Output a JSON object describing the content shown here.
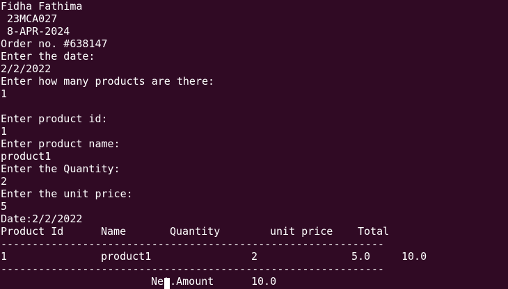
{
  "terminal": {
    "lines": [
      "Fidha Fathima",
      " 23MCA027",
      " 8-APR-2024",
      "Order no. #638147",
      "Enter the date:",
      "2/2/2022",
      "Enter how many products are there:",
      "1",
      "",
      "Enter product id:",
      "1",
      "Enter product name:",
      "product1",
      "Enter the Quantity:",
      "2",
      "Enter the unit price:",
      "5",
      "Date:2/2/2022"
    ],
    "table": {
      "headers": [
        "Product Id",
        "Name",
        "Quantity",
        "unit price",
        "Total"
      ],
      "separator": "-------------------------------------------------------------",
      "rows": [
        [
          "1",
          "product1",
          "2",
          "5.0",
          "10.0"
        ]
      ],
      "net_label": "Net.Amount",
      "net_value": "10.0"
    }
  }
}
